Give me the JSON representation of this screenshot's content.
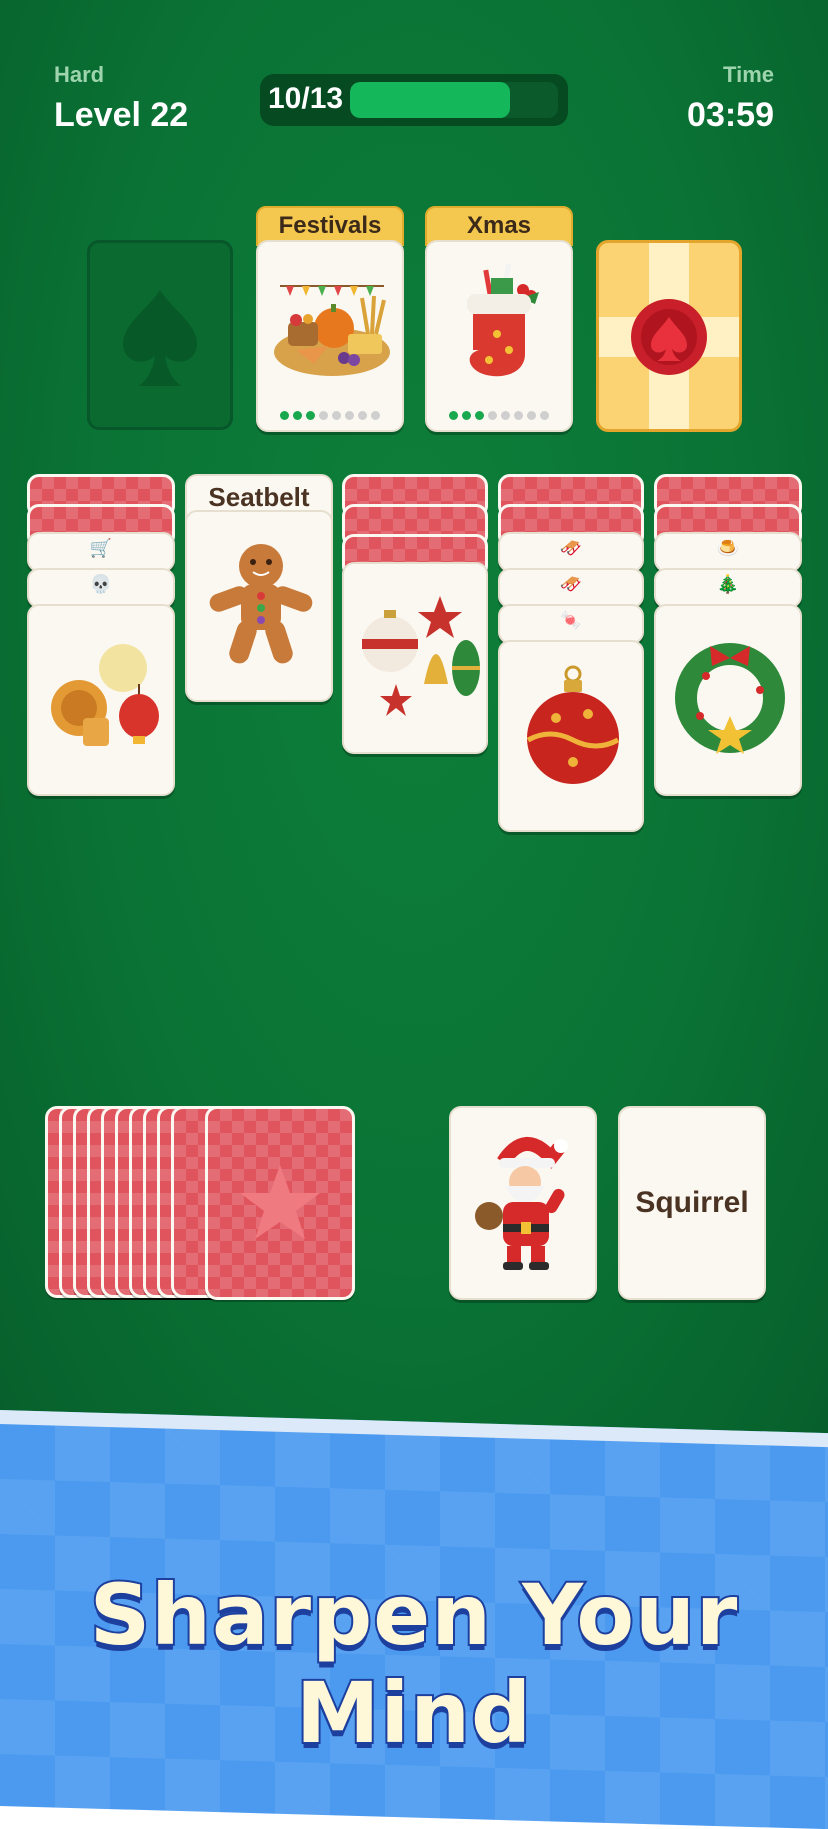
{
  "header": {
    "difficulty": "Hard",
    "level": "Level 22",
    "progress_label": "10/13",
    "progress_fraction": 0.77,
    "time_label": "Time",
    "time_value": "03:59"
  },
  "foundation": {
    "empty_slot_icon": "spade-icon",
    "category_cards": [
      {
        "title": "Festivals",
        "icon": "harvest-festival-icon",
        "dots_filled": 3,
        "dots_total": 8
      },
      {
        "title": "Xmas",
        "icon": "christmas-stocking-icon",
        "dots_filled": 3,
        "dots_total": 8
      }
    ],
    "sealed_card_icon": "wax-seal-spade-icon"
  },
  "tableau": {
    "column_2_word": "Seatbelt",
    "icons": {
      "col1": [
        "wagon-icon",
        "skull-icon",
        "mooncake-lantern-icon"
      ],
      "col2": [
        "gingerbread-man-icon"
      ],
      "col3": [
        "ornaments-icon"
      ],
      "col4": [
        "sleigh-icon",
        "sleigh-icon",
        "candy-icon",
        "bauble-icon"
      ],
      "col5": [
        "pudding-icon",
        "tree-icon",
        "wreath-icon"
      ]
    }
  },
  "waste": {
    "card_1_icon": "santa-icon",
    "card_2_word": "Squirrel"
  },
  "banner": {
    "slogan": "Sharpen Your Mind"
  }
}
